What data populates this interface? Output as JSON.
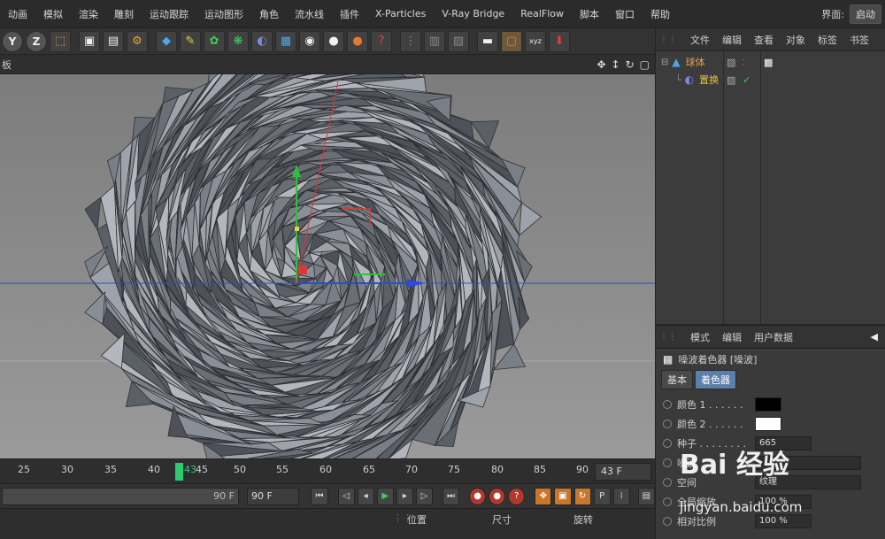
{
  "menubar": {
    "items": [
      "动画",
      "模拟",
      "渲染",
      "雕刻",
      "运动跟踪",
      "运动图形",
      "角色",
      "流水线",
      "插件",
      "X-Particles",
      "V-Ray Bridge",
      "RealFlow",
      "脚本",
      "窗口",
      "帮助"
    ],
    "layout_label": "界面:",
    "layout_value": "启动"
  },
  "toolbar": {
    "icons": [
      "y-axis-icon",
      "z-axis-icon",
      "coordinate-system-icon",
      "render-view-icon",
      "render-picture-viewer-icon",
      "render-settings-icon",
      "cube-icon",
      "pen-icon",
      "subdivision-icon",
      "cloner-icon",
      "deformer-icon",
      "floor-icon",
      "camera-icon",
      "light-icon",
      "material-icon",
      "tag-icon",
      "snap-icon",
      "grid-icon",
      "workplane-icon",
      "clapper-icon",
      "layout-icon",
      "axis-icon",
      "script-icon"
    ],
    "y_label": "Y",
    "z_label": "Z"
  },
  "viewport": {
    "label": "板"
  },
  "timeline": {
    "ticks": [
      "25",
      "30",
      "35",
      "40",
      "43",
      "45",
      "50",
      "55",
      "60",
      "65",
      "70",
      "75",
      "80",
      "85",
      "90"
    ],
    "current_frame": "43",
    "frame_field": "43 F"
  },
  "transport": {
    "range_end": "90 F",
    "end_frame": "90 F"
  },
  "coords": {
    "position": "位置",
    "size": "尺寸",
    "rotation": "旋转"
  },
  "object_manager": {
    "menu": [
      "文件",
      "编辑",
      "查看",
      "对象",
      "标签",
      "书签"
    ],
    "objects": [
      {
        "name": "球体",
        "color": "#e8a23a"
      },
      {
        "name": "置换",
        "color": "#e8c23a"
      }
    ]
  },
  "attribute_manager": {
    "menu": [
      "模式",
      "编辑",
      "用户数据"
    ],
    "title": "噪波着色器 [噪波]",
    "tabs": [
      "基本",
      "着色器"
    ],
    "active_tab": "着色器",
    "rows": [
      {
        "label": "颜色 1 . . . . . .",
        "type": "swatch",
        "color": "#000000"
      },
      {
        "label": "颜色 2 . . . . . .",
        "type": "swatch",
        "color": "#ffffff"
      },
      {
        "label": "种子 . . . . . . . .",
        "type": "field",
        "value": "665"
      },
      {
        "label": "噪波",
        "type": "field",
        "value": ""
      },
      {
        "label": "空间",
        "type": "field",
        "value": "纹理"
      },
      {
        "label": "全局缩放",
        "type": "field",
        "value": "100 %"
      },
      {
        "label": "相对比例",
        "type": "field",
        "value": "100 %"
      }
    ]
  },
  "watermark": {
    "text": "Bai 经验",
    "url": "jingyan.baidu.com"
  },
  "colors": {
    "accent_green": "#2ecc71",
    "axis_x": "#2b4bd8",
    "axis_y": "#2fbf3f",
    "axis_z": "#d83a3a"
  }
}
